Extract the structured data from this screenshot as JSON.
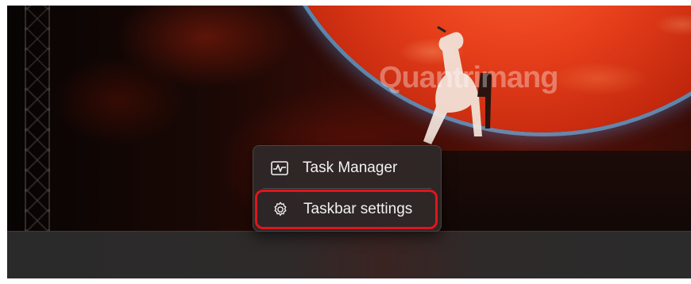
{
  "desktop": {
    "watermark_text": "Quantrimang"
  },
  "context_menu": {
    "items": [
      {
        "label": "Task Manager",
        "icon": "task-manager-icon"
      },
      {
        "label": "Taskbar settings",
        "icon": "gear-icon",
        "highlighted": true
      }
    ]
  },
  "colors": {
    "highlight_border": "#e0151d",
    "menu_background": "#2e2828",
    "taskbar_background": "#2b2b2b"
  }
}
